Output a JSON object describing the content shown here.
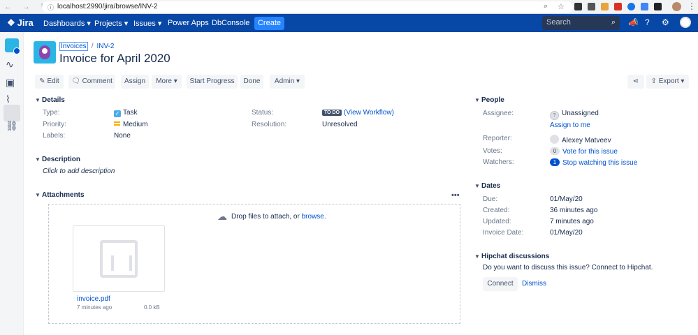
{
  "browser": {
    "url": "localhost:2990/jira/browse/INV-2",
    "nav_icons": [
      "back-icon",
      "forward-icon",
      "reload-icon"
    ]
  },
  "topnav": {
    "logo": "Jira",
    "items": [
      "Dashboards ▾",
      "Projects ▾",
      "Issues ▾",
      "Power Apps",
      "DbConsole"
    ],
    "create_label": "Create",
    "search_placeholder": "Search"
  },
  "breadcrumb": {
    "project": "Invoices",
    "sep": "/",
    "issue_key": "INV-2"
  },
  "issue": {
    "title": "Invoice for April 2020"
  },
  "toolbar": {
    "edit": "Edit",
    "comment": "Comment",
    "assign": "Assign",
    "more": "More ▾",
    "start_progress": "Start Progress",
    "done": "Done",
    "admin": "Admin ▾",
    "export": "Export ▾"
  },
  "details": {
    "heading": "Details",
    "type_label": "Type:",
    "type_value": "Task",
    "priority_label": "Priority:",
    "priority_value": "Medium",
    "labels_label": "Labels:",
    "labels_value": "None",
    "status_label": "Status:",
    "status_value": "TO DO",
    "view_workflow": "(View Workflow)",
    "resolution_label": "Resolution:",
    "resolution_value": "Unresolved"
  },
  "description": {
    "heading": "Description",
    "placeholder": "Click to add description"
  },
  "attachments": {
    "heading": "Attachments",
    "drop_text": "Drop files to attach, or ",
    "browse_link": "browse.",
    "file": {
      "name": "invoice.pdf",
      "age": "7 minutes ago",
      "size": "0.0 kB"
    }
  },
  "people": {
    "heading": "People",
    "assignee_label": "Assignee:",
    "assignee_value": "Unassigned",
    "assign_to_me": "Assign to me",
    "reporter_label": "Reporter:",
    "reporter_value": "Alexey Matveev",
    "votes_label": "Votes:",
    "votes_count": "0",
    "vote_link": "Vote for this issue",
    "watchers_label": "Watchers:",
    "watchers_count": "1",
    "watch_link": "Stop watching this issue"
  },
  "dates": {
    "heading": "Dates",
    "due_label": "Due:",
    "due_value": "01/May/20",
    "created_label": "Created:",
    "created_value": "36 minutes ago",
    "updated_label": "Updated:",
    "updated_value": "7 minutes ago",
    "invoice_date_label": "Invoice Date:",
    "invoice_date_value": "01/May/20"
  },
  "hipchat": {
    "heading": "Hipchat discussions",
    "prompt": "Do you want to discuss this issue? Connect to Hipchat.",
    "connect": "Connect",
    "dismiss": "Dismiss"
  },
  "colors": {
    "brand": "#0747a6",
    "create": "#2684ff",
    "link": "#0052cc",
    "project_avatar": "#2ab5e5"
  }
}
